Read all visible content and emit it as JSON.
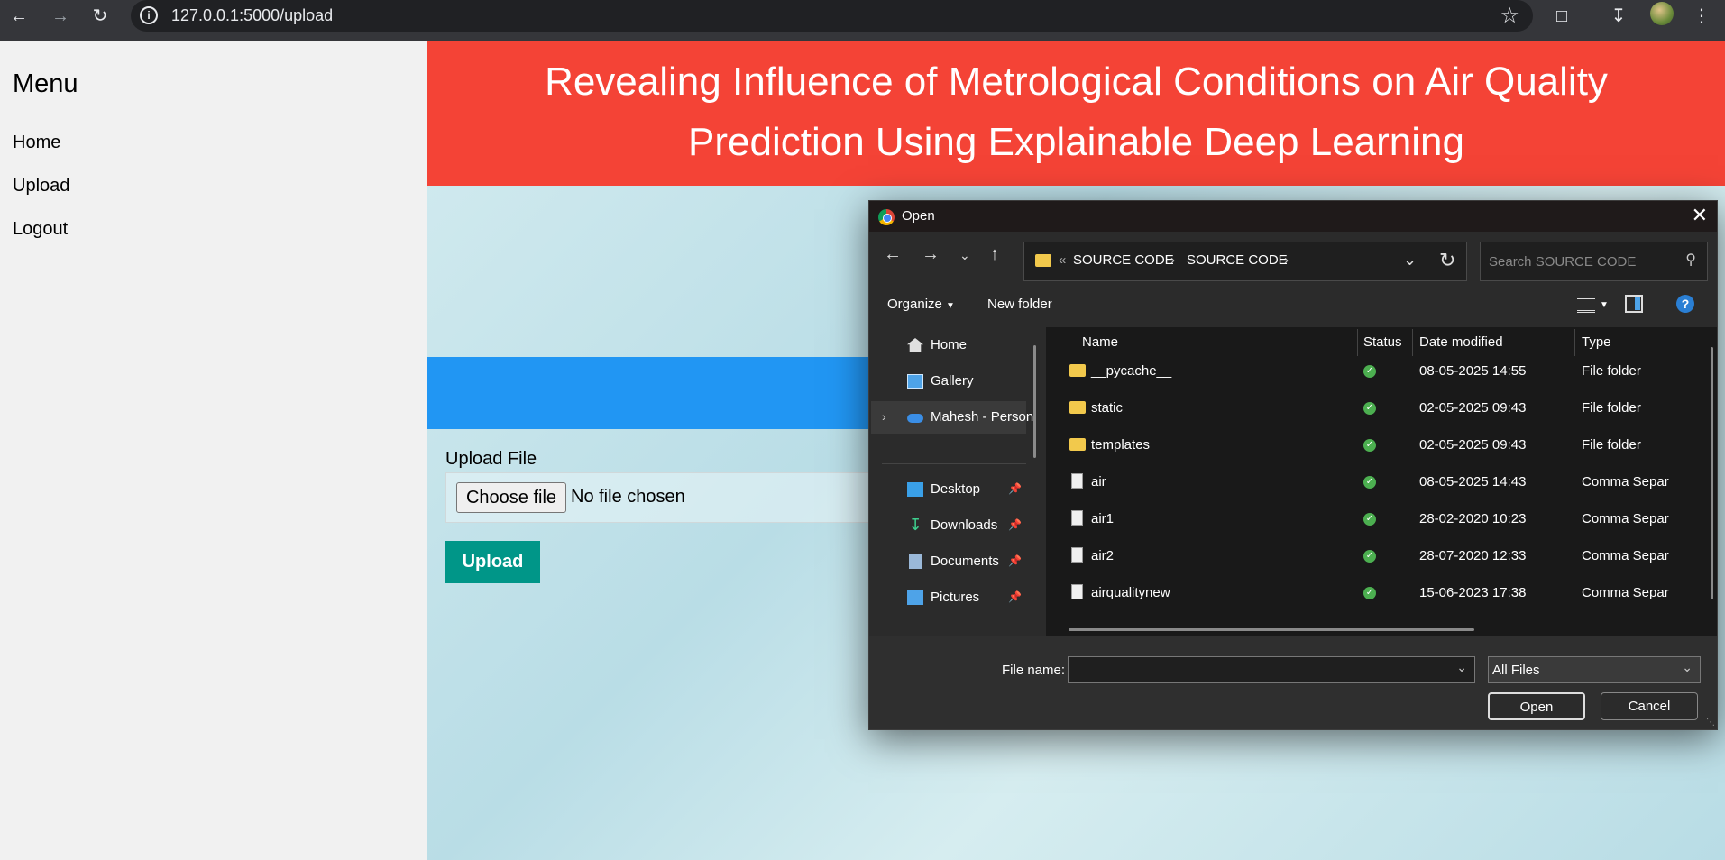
{
  "browser": {
    "url": "127.0.0.1:5000/upload"
  },
  "sidebar": {
    "title": "Menu",
    "items": [
      {
        "label": "Home"
      },
      {
        "label": "Upload"
      },
      {
        "label": "Logout"
      }
    ]
  },
  "header": {
    "title_line1": "Revealing Influence of Metrological Conditions on Air Quality",
    "title_line2": "Prediction Using Explainable Deep Learning"
  },
  "upload_form": {
    "label": "Upload File",
    "choose_button": "Choose file",
    "no_file_text": "No file chosen",
    "upload_button": "Upload"
  },
  "dialog": {
    "title": "Open",
    "breadcrumb": [
      "SOURCE CODE",
      "SOURCE CODE"
    ],
    "breadcrumb_prefix": "«",
    "search_placeholder": "Search SOURCE CODE",
    "organize_label": "Organize",
    "new_folder_label": "New folder",
    "nav_items": [
      {
        "label": "Home",
        "icon": "home-icon"
      },
      {
        "label": "Gallery",
        "icon": "gallery-icon"
      },
      {
        "label": "Mahesh - Person",
        "icon": "onedrive-icon"
      },
      {
        "label": "Desktop",
        "icon": "desktop-icon"
      },
      {
        "label": "Downloads",
        "icon": "download-icon"
      },
      {
        "label": "Documents",
        "icon": "documents-icon"
      },
      {
        "label": "Pictures",
        "icon": "pictures-icon"
      }
    ],
    "columns": [
      "Name",
      "Status",
      "Date modified",
      "Type"
    ],
    "files": [
      {
        "name": "__pycache__",
        "date": "08-05-2025 14:55",
        "type": "File folder",
        "kind": "folder"
      },
      {
        "name": "static",
        "date": "02-05-2025 09:43",
        "type": "File folder",
        "kind": "folder"
      },
      {
        "name": "templates",
        "date": "02-05-2025 09:43",
        "type": "File folder",
        "kind": "folder"
      },
      {
        "name": "air",
        "date": "08-05-2025 14:43",
        "type": "Comma Separ",
        "kind": "doc"
      },
      {
        "name": "air1",
        "date": "28-02-2020 10:23",
        "type": "Comma Separ",
        "kind": "doc"
      },
      {
        "name": "air2",
        "date": "28-07-2020 12:33",
        "type": "Comma Separ",
        "kind": "doc"
      },
      {
        "name": "airqualitynew",
        "date": "15-06-2023 17:38",
        "type": "Comma Separ",
        "kind": "doc"
      }
    ],
    "file_name_label": "File name:",
    "file_name_value": "",
    "file_type_value": "All Files",
    "open_button": "Open",
    "cancel_button": "Cancel"
  }
}
